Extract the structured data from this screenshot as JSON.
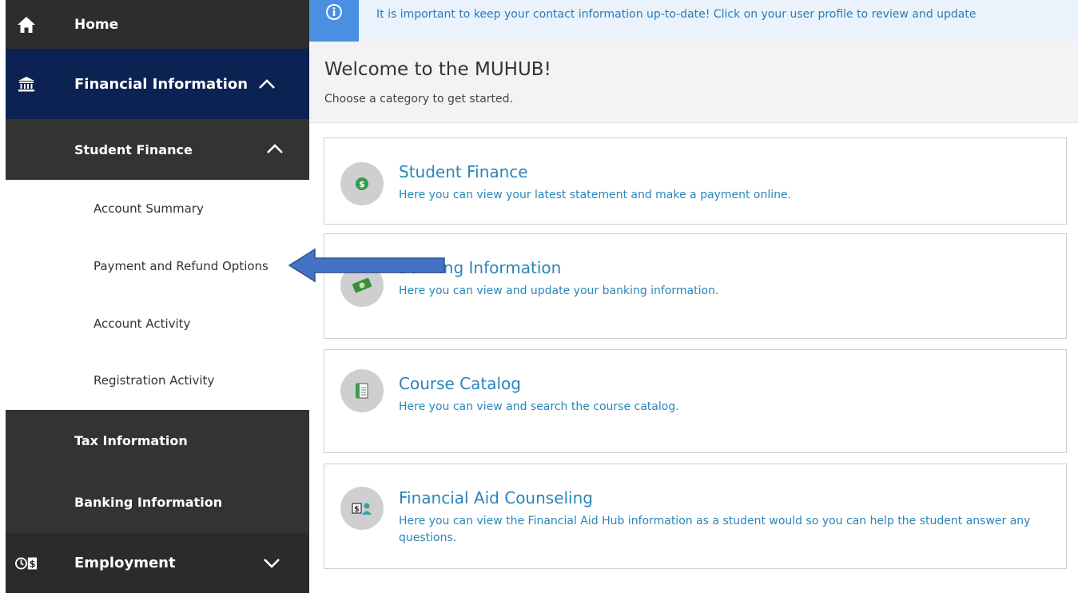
{
  "sidebar": {
    "home": {
      "label": "Home",
      "icon": "home-icon"
    },
    "financial": {
      "label": "Financial Information",
      "icon": "bank-icon",
      "expanded": true
    },
    "student_finance": {
      "label": "Student Finance",
      "expanded": true,
      "items": [
        {
          "label": "Account Summary"
        },
        {
          "label": "Payment and Refund Options"
        },
        {
          "label": "Account Activity"
        },
        {
          "label": "Registration Activity"
        }
      ]
    },
    "tax": {
      "label": "Tax Information"
    },
    "banking": {
      "label": "Banking Information"
    },
    "employment": {
      "label": "Employment",
      "icon": "clock-dollar-icon",
      "expanded": false
    }
  },
  "banner": {
    "text": "It is important to keep your contact information up-to-date! Click on your user profile to review and update",
    "icon": "info-icon"
  },
  "welcome": {
    "title": "Welcome to the MUHUB!",
    "subtitle": "Choose a category to get started."
  },
  "cards": [
    {
      "title": "Student Finance",
      "desc": "Here you can view your latest statement and make a payment online.",
      "icon": "dollar-coin-icon"
    },
    {
      "title": "Banking Information",
      "desc": "Here you can view and update your banking information.",
      "icon": "money-icon"
    },
    {
      "title": "Course Catalog",
      "desc": "Here you can view and search the course catalog.",
      "icon": "notebook-icon"
    },
    {
      "title": "Financial Aid Counseling",
      "desc": "Here you can view the Financial Aid Hub information as a student would so you can help the student answer any questions.",
      "icon": "counselor-icon"
    }
  ],
  "colors": {
    "sidebar_dark": "#333333",
    "sidebar_active": "#0b2252",
    "link_blue": "#2a85b8",
    "banner_blue": "#4a90e2",
    "arrow_blue": "#4472c4"
  }
}
